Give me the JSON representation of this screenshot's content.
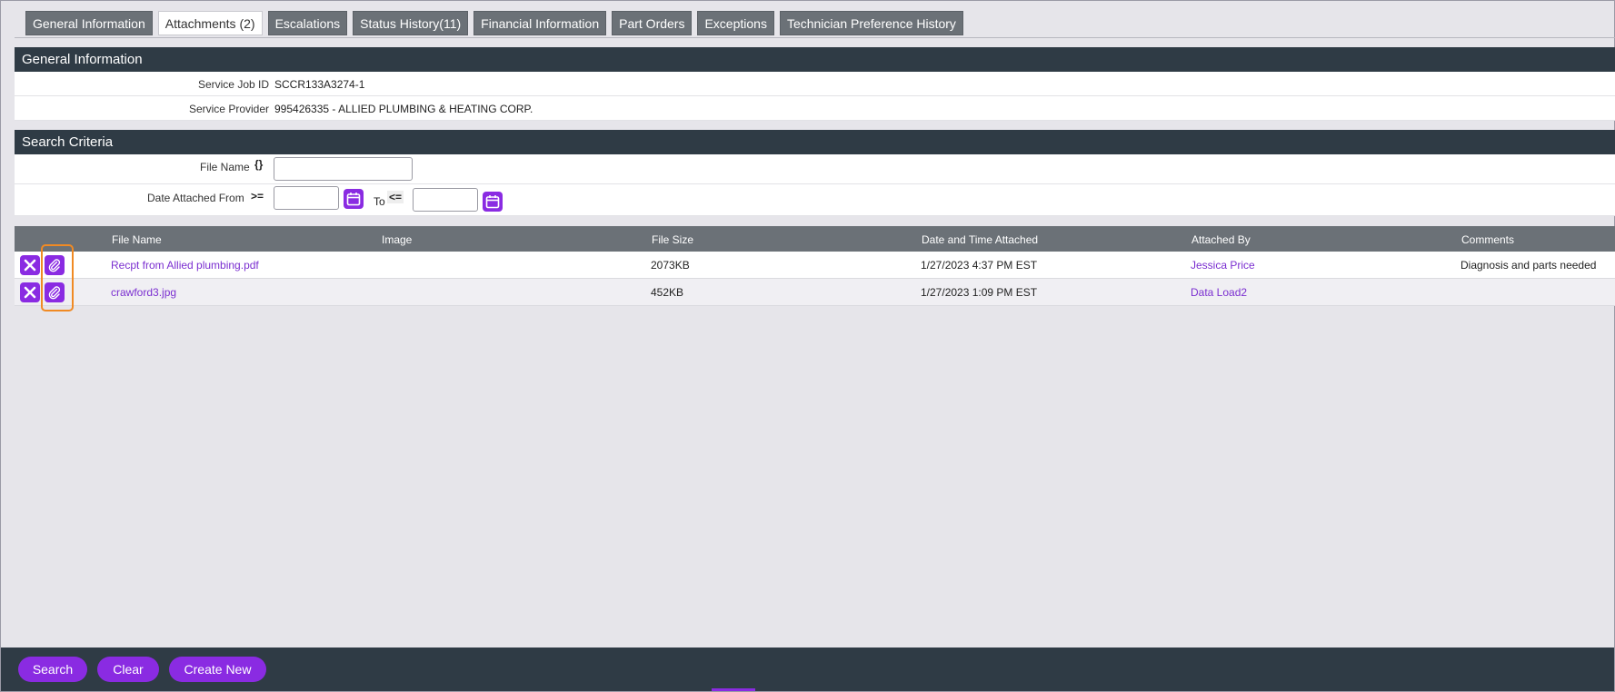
{
  "tabs": [
    {
      "label": "General Information",
      "active": false
    },
    {
      "label": "Attachments (2)",
      "active": true
    },
    {
      "label": "Escalations",
      "active": false
    },
    {
      "label": "Status History(11)",
      "active": false
    },
    {
      "label": "Financial Information",
      "active": false
    },
    {
      "label": "Part Orders",
      "active": false
    },
    {
      "label": "Exceptions",
      "active": false
    },
    {
      "label": "Technician Preference History",
      "active": false
    }
  ],
  "general_info": {
    "title": "General Information",
    "service_job_id_label": "Service Job ID",
    "service_job_id": "SCCR133A3274-1",
    "service_provider_label": "Service Provider",
    "service_provider": "995426335 - ALLIED PLUMBING & HEATING CORP."
  },
  "search_criteria": {
    "title": "Search Criteria",
    "file_name_label": "File Name",
    "file_name_op": "{}",
    "file_name_value": "",
    "date_from_label": "Date Attached From",
    "date_from_op": ">=",
    "date_from_value": "",
    "date_to_label": "To",
    "date_to_op": "<=",
    "date_to_value": ""
  },
  "table": {
    "columns": [
      "File Name",
      "Image",
      "File Size",
      "Date and Time Attached",
      "Attached By",
      "Comments"
    ],
    "rows": [
      {
        "file_name": "Recpt from Allied plumbing.pdf",
        "image": "",
        "file_size": "2073KB",
        "attached": "1/27/2023 4:37 PM EST",
        "attached_by": "Jessica Price",
        "comments": "Diagnosis and parts needed"
      },
      {
        "file_name": "crawford3.jpg",
        "image": "",
        "file_size": "452KB",
        "attached": "1/27/2023 1:09 PM EST",
        "attached_by": "Data Load2",
        "comments": ""
      }
    ]
  },
  "footer": {
    "search_label": "Search",
    "clear_label": "Clear",
    "create_new_label": "Create New"
  },
  "colors": {
    "accent": "#8a2be2",
    "header_bg": "#2f3b45",
    "tab_bg": "#6b7177",
    "highlight": "#f08a24"
  },
  "icons": [
    "delete-icon",
    "attachment-icon",
    "calendar-icon"
  ]
}
